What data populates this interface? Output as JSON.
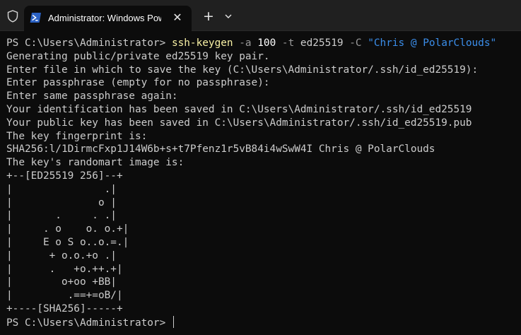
{
  "tab": {
    "title": "Administrator: Windows Powe",
    "close_glyph": "✕",
    "new_tab_glyph": "+"
  },
  "icons": {
    "shield": "shield-icon",
    "powershell": "powershell-icon",
    "close": "close-icon",
    "new_tab": "plus-icon",
    "dropdown": "chevron-down-icon"
  },
  "colors": {
    "background": "#0c0c0c",
    "titlebar": "#202020",
    "text": "#cccccc",
    "command": "#f9f1a5",
    "parameter": "#9a9a9a",
    "string": "#3b8eea",
    "powershell_icon": "#2b62c4"
  },
  "terminal": {
    "command_line": {
      "prompt": "PS C:\\Users\\Administrator> ",
      "command": "ssh-keygen",
      "parts": [
        {
          "kind": "sep",
          "text": " "
        },
        {
          "kind": "param",
          "text": "-a"
        },
        {
          "kind": "sep",
          "text": " "
        },
        {
          "kind": "num",
          "text": "100"
        },
        {
          "kind": "sep",
          "text": " "
        },
        {
          "kind": "param",
          "text": "-t"
        },
        {
          "kind": "plain",
          "text": " ed25519 "
        },
        {
          "kind": "param",
          "text": "-C"
        },
        {
          "kind": "sep",
          "text": " "
        },
        {
          "kind": "str",
          "text": "\"Chris @ PolarClouds\""
        }
      ]
    },
    "output_lines": [
      "Generating public/private ed25519 key pair.",
      "Enter file in which to save the key (C:\\Users\\Administrator/.ssh/id_ed25519):",
      "Enter passphrase (empty for no passphrase):",
      "Enter same passphrase again:",
      "Your identification has been saved in C:\\Users\\Administrator/.ssh/id_ed25519",
      "Your public key has been saved in C:\\Users\\Administrator/.ssh/id_ed25519.pub",
      "The key fingerprint is:",
      "SHA256:l/1DirmcFxp1J14W6b+s+t7Pfenz1r5vB84i4wSwW4I Chris @ PolarClouds",
      "The key's randomart image is:",
      "+--[ED25519 256]--+",
      "|               .|",
      "|              o |",
      "|       .     . .|",
      "|     . o    o. o.+|",
      "|     E o S o..o.=.|",
      "|      + o.o.+o .|",
      "|      .   +o.++.+|",
      "|        o+oo +BB|",
      "|         .==+=oB/|",
      "+----[SHA256]-----+"
    ],
    "final_prompt": "PS C:\\Users\\Administrator> "
  }
}
